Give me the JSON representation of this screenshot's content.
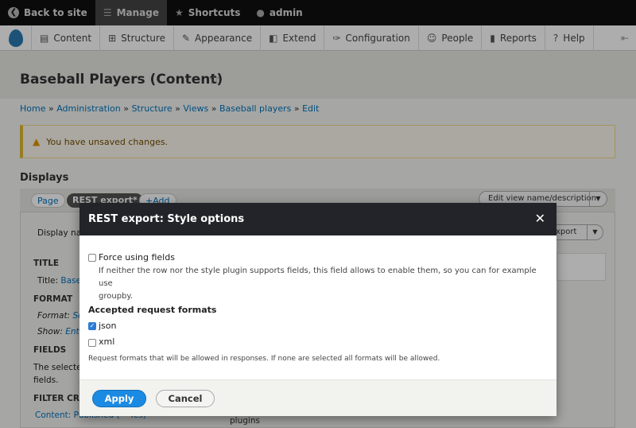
{
  "toolbar": {
    "back_label": "Back to site",
    "manage_label": "Manage",
    "shortcuts_label": "Shortcuts",
    "user_label": "admin"
  },
  "tray": {
    "items": [
      "Content",
      "Structure",
      "Appearance",
      "Extend",
      "Configuration",
      "People",
      "Reports",
      "Help"
    ]
  },
  "page": {
    "title": "Baseball Players (Content)",
    "breadcrumb": [
      "Home",
      "Administration",
      "Structure",
      "Views",
      "Baseball players",
      "Edit"
    ],
    "breadcrumb_sep": "»",
    "warning": "You have unsaved changes.",
    "displays_title": "Displays",
    "tabs": {
      "page": "Page",
      "rest": "REST export*",
      "add": "+Add"
    },
    "edit_view_label": "Edit view name/description",
    "display_name_label": "Display na",
    "export_label": "export",
    "left": {
      "title_h": "TITLE",
      "title_row_label": "Title:",
      "title_row_value": "Basel",
      "format_h": "FORMAT",
      "format_row_label": "Format:",
      "format_row_value": "Se",
      "show_row_label": "Show:",
      "show_row_value": "Enti",
      "fields_h": "FIELDS",
      "fields_text_1": "The selected",
      "fields_text_2": "fields.",
      "filter_h": "FILTER CRI",
      "filter_row": "Content: Published (= Yes)"
    },
    "plugins_text": "plugins"
  },
  "modal": {
    "title": "REST export: Style options",
    "close_label": "✕",
    "force_label": "Force using fields",
    "force_desc_1": "If neither the row nor the style plugin supports fields, this field allows to enable them, so you can for example use",
    "force_desc_2": "groupby.",
    "formats_heading": "Accepted request formats",
    "formats": [
      {
        "label": "json",
        "checked": true
      },
      {
        "label": "xml",
        "checked": false
      }
    ],
    "formats_desc": "Request formats that will be allowed in responses. If none are selected all formats will be allowed.",
    "apply_label": "Apply",
    "cancel_label": "Cancel"
  },
  "colors": {
    "accent": "#1b8ae2",
    "link": "#0074bd",
    "modal_header": "#232429",
    "toolbar": "#0f0f0f"
  }
}
